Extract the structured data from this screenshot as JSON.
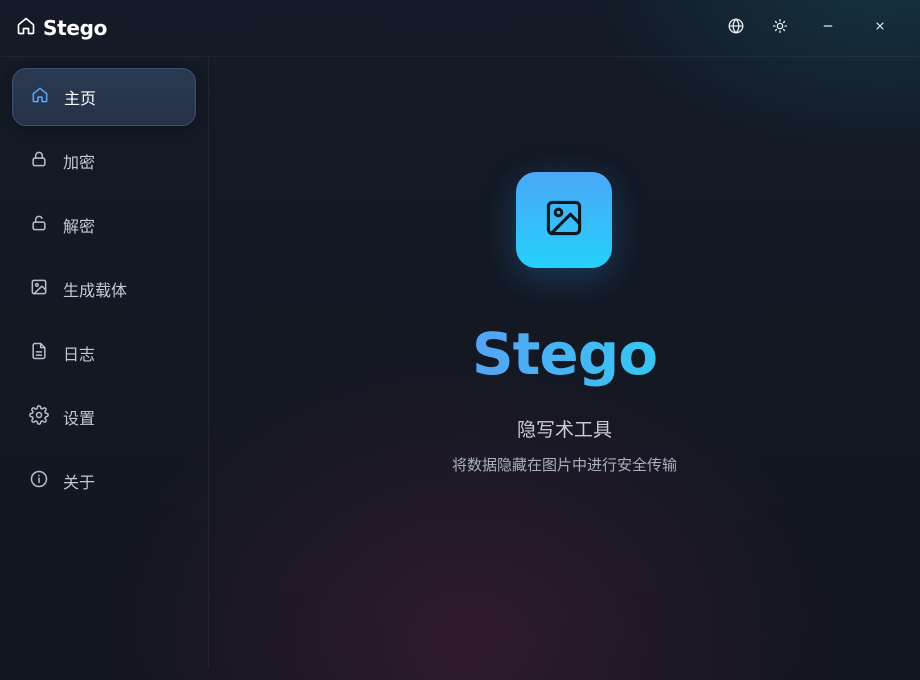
{
  "app": {
    "title": "Stego"
  },
  "titlebar": {
    "buttons": [
      {
        "icon": "globe-icon",
        "label": "language"
      },
      {
        "icon": "sun-icon",
        "label": "theme"
      },
      {
        "icon": "minimize-icon",
        "label": "minimize"
      },
      {
        "icon": "close-icon",
        "label": "close"
      }
    ]
  },
  "sidebar": {
    "items": [
      {
        "label": "主页",
        "icon": "home-icon",
        "active": true
      },
      {
        "label": "加密",
        "icon": "lock-icon"
      },
      {
        "label": "解密",
        "icon": "unlock-icon"
      },
      {
        "label": "生成载体",
        "icon": "image-icon"
      },
      {
        "label": "日志",
        "icon": "document-icon"
      },
      {
        "label": "设置",
        "icon": "gear-icon"
      },
      {
        "label": "关于",
        "icon": "info-icon"
      }
    ]
  },
  "hero": {
    "icon": "image-icon",
    "title": "Stego",
    "subtitle": "隐写术工具",
    "description": "将数据隐藏在图片中进行安全传输"
  },
  "colors": {
    "accent": "#4aa8f8",
    "accent_cyan": "#25d0fa",
    "background": "#12161f",
    "active_item": "#2b3a52"
  }
}
